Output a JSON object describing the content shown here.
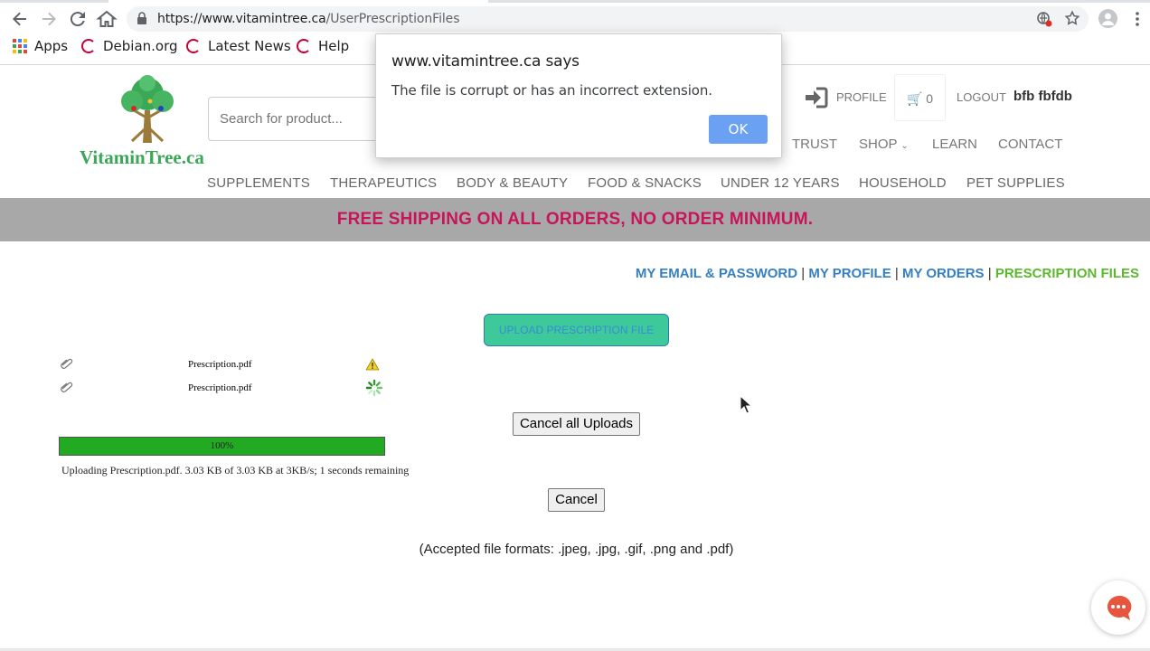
{
  "browser": {
    "url_host": "https://www.vitamintree.ca",
    "url_path": "/UserPrescriptionFiles",
    "bookmarks": [
      "Apps",
      "Debian.org",
      "Latest News",
      "Help"
    ]
  },
  "site": {
    "logo_text": "VitaminTree.ca",
    "search_placeholder": "Search for product...",
    "profile_label": "PROFILE",
    "cart_count": "0",
    "logout_label": "LOGOUT",
    "username": "bfb fbfdb",
    "main_nav": [
      "TRUST",
      "SHOP",
      "LEARN",
      "CONTACT"
    ],
    "category_nav": [
      "SUPPLEMENTS",
      "THERAPEUTICS",
      "BODY & BEAUTY",
      "FOOD & SNACKS",
      "UNDER 12 YEARS",
      "HOUSEHOLD",
      "PET SUPPLIES"
    ],
    "shipping_banner": "FREE SHIPPING ON ALL ORDERS, NO ORDER MINIMUM."
  },
  "account_nav": {
    "email_password": "MY EMAIL & PASSWORD",
    "profile": "MY PROFILE",
    "orders": "MY ORDERS",
    "prescription_files": "PRESCRIPTION FILES",
    "separator": "|"
  },
  "uploads": {
    "upload_button": "UPLOAD PRESCRIPTION FILE",
    "files": [
      {
        "name": "Prescription.pdf",
        "status": "warning-icon"
      },
      {
        "name": "Prescription.pdf",
        "status": "loading-spinner-icon"
      }
    ],
    "cancel_all_label": "Cancel all Uploads",
    "progress_label": "100%",
    "progress_fraction": 1.0,
    "status_text": "Uploading Prescription.pdf. 3.03 KB of 3.03 KB at 3KB/s; 1 seconds remaining",
    "cancel_label": "Cancel",
    "accepted_formats": "(Accepted file formats: .jpeg, .jpg, .gif, .png and .pdf)"
  },
  "alert": {
    "title": "www.vitamintree.ca says",
    "message": "The file is corrupt or has an incorrect extension.",
    "ok_label": "OK"
  },
  "colors": {
    "brand_green": "#3aa856",
    "banner_text": "#c8145a",
    "link_blue": "#3480c3",
    "active_green": "#5ab92c",
    "upload_button": "#3ec99a",
    "progress_fill": "#22aa22",
    "alert_ok": "#6ba1f2"
  }
}
